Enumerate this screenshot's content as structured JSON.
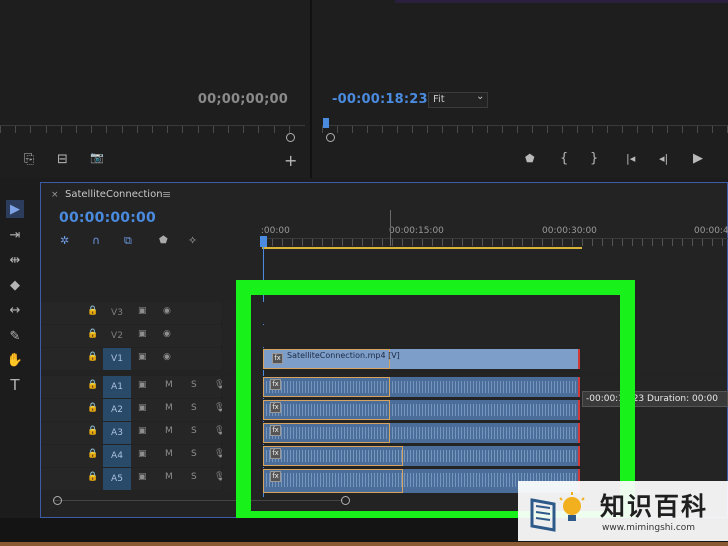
{
  "source_monitor": {
    "timecode": "00;00;00;00"
  },
  "program_monitor": {
    "timecode": "-00:00:18:23",
    "zoom": "Fit",
    "zoom_arrow": "⌄"
  },
  "source_controls": {
    "insert_icon": "⎘",
    "overwrite_icon": "⊟",
    "camera_icon": "📷",
    "add_icon": "+"
  },
  "program_controls": {
    "marker": "⬟",
    "in": "{",
    "out": "}",
    "goto_in": "|◂",
    "step_back": "◂|",
    "play": "▶"
  },
  "timeline": {
    "sequence_name": "SatelliteConnection",
    "close_icon": "×",
    "menu_icon": "≡",
    "timecode": "00:00:00:00",
    "ruler": [
      " :00:00",
      "00:00:15:00",
      "00:00:30:00",
      "00:00:4"
    ],
    "tracks": [
      {
        "name": "V3",
        "type": "video",
        "targeted": false
      },
      {
        "name": "V2",
        "type": "video",
        "targeted": false
      },
      {
        "name": "V1",
        "type": "video",
        "targeted": true
      },
      {
        "name": "A1",
        "type": "audio",
        "targeted": true
      },
      {
        "name": "A2",
        "type": "audio",
        "targeted": true
      },
      {
        "name": "A3",
        "type": "audio",
        "targeted": true
      },
      {
        "name": "A4",
        "type": "audio",
        "targeted": true
      },
      {
        "name": "A5",
        "type": "audio",
        "targeted": true
      }
    ],
    "mute_label": "M",
    "solo_label": "S",
    "clip_name": "SatelliteConnection.mp4 [V]",
    "fx_label": "fx",
    "tooltip": "-00:00:18:23 Duration: 00:00"
  },
  "watermark": {
    "title": "知识百科",
    "url": "www.mimingshi.com"
  },
  "colors": {
    "highlight": "#19f21a",
    "timecode_blue": "#4a8bdf",
    "accent": "#3d5ba9"
  }
}
